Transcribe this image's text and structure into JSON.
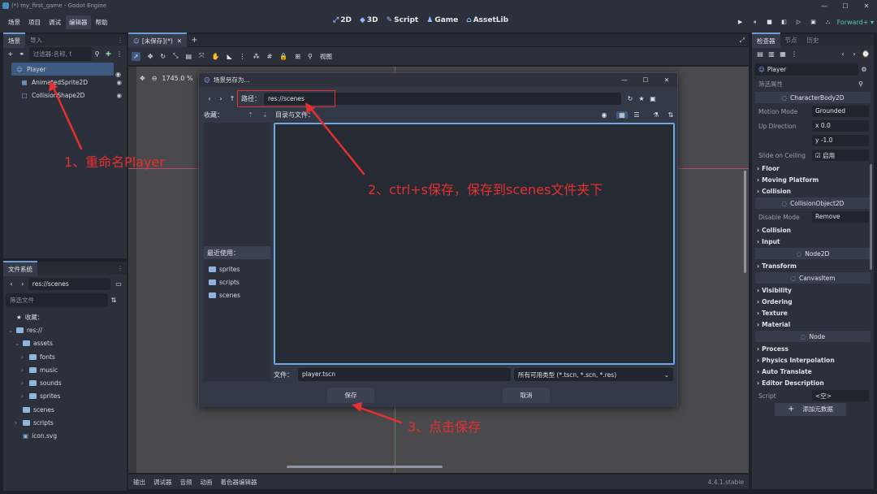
{
  "titlebar": {
    "title": "(*) my_first_game - Godot Engine",
    "min": "—",
    "max": "☐",
    "close": "✕"
  },
  "menus": [
    "场景",
    "项目",
    "调试",
    "编辑器",
    "帮助"
  ],
  "modes": [
    {
      "icon": "⤢",
      "label": "2D"
    },
    {
      "icon": "◆",
      "label": "3D"
    },
    {
      "icon": "✎",
      "label": "Script"
    },
    {
      "icon": "♟",
      "label": "Game"
    },
    {
      "icon": "⌂",
      "label": "AssetLib"
    }
  ],
  "run_buttons": [
    "▶",
    "⏸",
    "■",
    "◧",
    "▷",
    "▣",
    "⛬"
  ],
  "renderer": "Forward+ ▾",
  "scene_dock": {
    "tabs": [
      "场景",
      "导入"
    ],
    "filter_placeholder": "过滤器:名称, t",
    "nodes": [
      {
        "icon": "☺",
        "label": "Player",
        "selected": true
      },
      {
        "icon": "▦",
        "label": "AnimatedSprite2D"
      },
      {
        "icon": "□",
        "label": "CollisionShape2D"
      }
    ]
  },
  "filesystem": {
    "tab": "文件系统",
    "path": "res://scenes",
    "filter_placeholder": "筛选文件",
    "items": [
      {
        "indent": 0,
        "arrow": "",
        "icon": "star",
        "label": "收藏："
      },
      {
        "indent": 0,
        "arrow": "⌄",
        "icon": "folder",
        "label": "res://"
      },
      {
        "indent": 1,
        "arrow": "⌄",
        "icon": "folder",
        "label": "assets"
      },
      {
        "indent": 2,
        "arrow": "›",
        "icon": "folder",
        "label": "fonts"
      },
      {
        "indent": 2,
        "arrow": "›",
        "icon": "folder",
        "label": "music"
      },
      {
        "indent": 2,
        "arrow": "›",
        "icon": "folder",
        "label": "sounds"
      },
      {
        "indent": 2,
        "arrow": "›",
        "icon": "folder",
        "label": "sprites"
      },
      {
        "indent": 1,
        "arrow": "",
        "icon": "folder",
        "label": "scenes"
      },
      {
        "indent": 1,
        "arrow": "›",
        "icon": "folder",
        "label": "scripts"
      },
      {
        "indent": 1,
        "arrow": "",
        "icon": "file",
        "label": "icon.svg"
      }
    ]
  },
  "editor_tab": {
    "label": "[未保存](*)",
    "close": "✕",
    "add": "+"
  },
  "viewport": {
    "zoom": "1745.0 %",
    "view_label": "视图",
    "tools": [
      "➚",
      "✥",
      "↻",
      "⤡",
      "▤",
      "⤧",
      "✋",
      "◣",
      "⋮",
      "⁂",
      "#",
      "🔒",
      "⊞",
      "⚲"
    ]
  },
  "bottom_tabs": [
    "输出",
    "调试器",
    "音频",
    "动画",
    "着色器编辑器"
  ],
  "version": "4.4.1.stable",
  "inspector": {
    "tabs": [
      "检查器",
      "节点",
      "历史"
    ],
    "node_name": "Player",
    "filter_placeholder": "筛选属性",
    "sections": [
      {
        "type": "class",
        "label": "CharacterBody2D"
      },
      {
        "type": "prop",
        "label": "Motion Mode",
        "value": "Grounded"
      },
      {
        "type": "prop",
        "label": "Up Direction",
        "value": "x  0.0"
      },
      {
        "type": "prop",
        "label": "",
        "value": "y  -1.0"
      },
      {
        "type": "prop",
        "label": "Slide on Ceiling",
        "value": "☑ 启用"
      },
      {
        "type": "group",
        "label": "Floor"
      },
      {
        "type": "group",
        "label": "Moving Platform"
      },
      {
        "type": "group",
        "label": "Collision"
      },
      {
        "type": "class",
        "label": "CollisionObject2D"
      },
      {
        "type": "prop",
        "label": "Disable Mode",
        "value": "Remove"
      },
      {
        "type": "group",
        "label": "Collision"
      },
      {
        "type": "group",
        "label": "Input"
      },
      {
        "type": "class",
        "label": "Node2D"
      },
      {
        "type": "group",
        "label": "Transform"
      },
      {
        "type": "class",
        "label": "CanvasItem"
      },
      {
        "type": "group",
        "label": "Visibility"
      },
      {
        "type": "group",
        "label": "Ordering"
      },
      {
        "type": "group",
        "label": "Texture"
      },
      {
        "type": "group",
        "label": "Material"
      },
      {
        "type": "class",
        "label": "Node"
      },
      {
        "type": "group",
        "label": "Process"
      },
      {
        "type": "group",
        "label": "Physics Interpolation"
      },
      {
        "type": "group",
        "label": "Auto Translate"
      },
      {
        "type": "group",
        "label": "Editor Description"
      },
      {
        "type": "prop",
        "label": "Script",
        "value": "<空>"
      }
    ],
    "add_metadata": "添加元数据"
  },
  "dialog": {
    "title": "场景另存为...",
    "path_label": "路径：",
    "path_value": "res://scenes",
    "favorites_label": "收藏：",
    "dirs_files_label": "目录与文件：",
    "recent_label": "最近使用：",
    "recent": [
      "sprites",
      "scripts",
      "scenes"
    ],
    "file_label": "文件：",
    "file_value": "player.tscn",
    "filter_value": "所有可用类型 (*.tscn, *.scn, *.res)",
    "save_button": "保存",
    "cancel_button": "取消"
  },
  "annotations": {
    "step1": "1、重命名Player",
    "step2": "2、ctrl+s保存，保存到scenes文件夹下",
    "step3": "3、点击保存"
  },
  "colors": {
    "accent": "#478cbf",
    "annotation": "#e53030",
    "selection": "#3f5a80"
  }
}
